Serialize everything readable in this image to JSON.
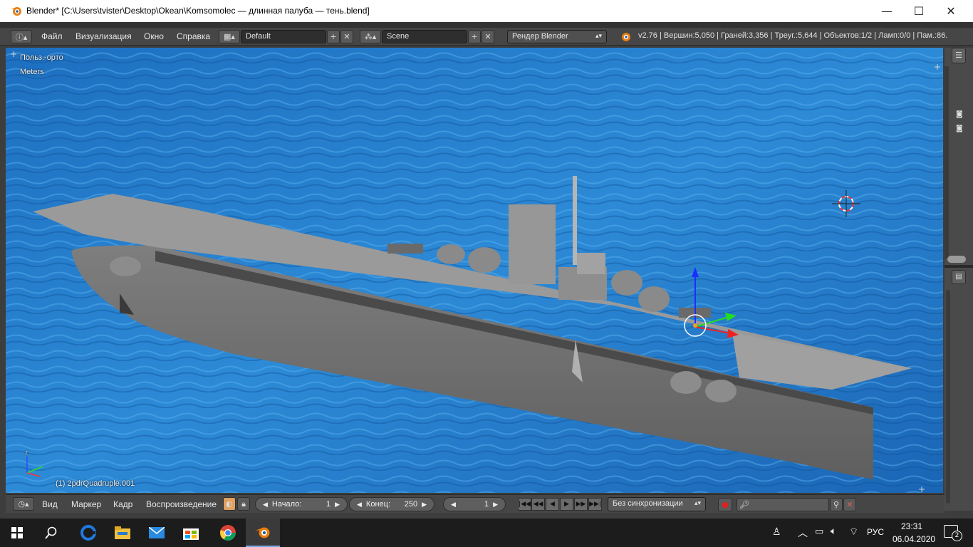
{
  "window": {
    "title": "Blender* [C:\\Users\\tvister\\Desktop\\Okean\\Komsomolec — длинная палуба — тень.blend]",
    "minimize": "—",
    "maximize": "☐",
    "close": "✕"
  },
  "infobar": {
    "menus": [
      "Файл",
      "Визуализация",
      "Окно",
      "Справка"
    ],
    "screen_layout": "Default",
    "scene": "Scene",
    "render_engine": "Рендер Blender",
    "stats": "v2.76 | Вершин:5,050 | Граней:3,356 | Треуг.:5,644 | Объектов:1/2 | Ламп:0/0 | Пам.:86."
  },
  "viewport": {
    "view_name": "Польз.-орто",
    "units": "Meters",
    "active_object": "(1) 2pdrQuadruple.001",
    "axis_labels": {
      "z": "z",
      "y": "y",
      "x": "x"
    }
  },
  "timeline": {
    "menus": [
      "Вид",
      "Маркер",
      "Кадр",
      "Воспроизведение"
    ],
    "start_label": "Начало:",
    "start_value": "1",
    "end_label": "Конец:",
    "end_value": "250",
    "current_frame": "1",
    "sync_mode": "Без синхронизации"
  },
  "taskbar": {
    "language": "РУС",
    "time": "23:31",
    "date": "06.04.2020",
    "notifications": "2"
  },
  "colors": {
    "blender_orange": "#e87d0d",
    "ui_gray": "#464646",
    "sea_blue": "#1e78c8",
    "hull_gray": "#8a8a8a",
    "deck_gray": "#9a9a9a"
  }
}
